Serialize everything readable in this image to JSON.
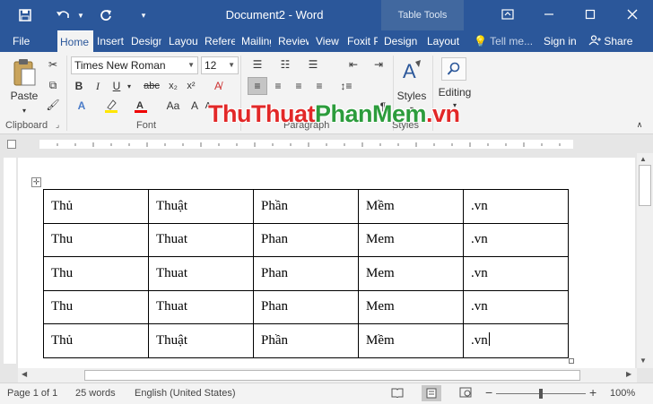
{
  "window": {
    "title": "Document2 - Word",
    "context_tab_group": "Table Tools",
    "accent_color": "#2b579a"
  },
  "quick_access": {
    "save_icon": "save-icon",
    "undo_icon": "undo-icon",
    "redo_icon": "redo-icon",
    "customize_icon": "chevron-down-icon"
  },
  "tabs": [
    {
      "label": "File",
      "active": false
    },
    {
      "label": "Home",
      "active": true
    },
    {
      "label": "Insert",
      "active": false
    },
    {
      "label": "Design",
      "active": false
    },
    {
      "label": "Layout",
      "active": false
    },
    {
      "label": "References",
      "active": false
    },
    {
      "label": "Mailings",
      "active": false
    },
    {
      "label": "Review",
      "active": false
    },
    {
      "label": "View",
      "active": false
    },
    {
      "label": "Foxit PDF",
      "active": false
    },
    {
      "label": "Design",
      "active": false
    },
    {
      "label": "Layout",
      "active": false
    }
  ],
  "tell_me": "Tell me...",
  "sign_in": "Sign in",
  "share": "Share",
  "ribbon": {
    "paste": "Paste",
    "font_name": "Times New Roman",
    "font_size": "12",
    "styles": "Styles",
    "editing": "Editing",
    "groups": [
      "Clipboard",
      "Font",
      "Paragraph",
      "Styles"
    ]
  },
  "watermark": {
    "part1": "ThuThuat",
    "part2": "PhanMem",
    "part3": ".vn"
  },
  "table": {
    "rows": [
      [
        "Thủ",
        "Thuật",
        "Phần",
        "Mềm",
        ".vn"
      ],
      [
        "Thu",
        "Thuat",
        "Phan",
        "Mem",
        ".vn"
      ],
      [
        "Thu",
        "Thuat",
        "Phan",
        "Mem",
        ".vn"
      ],
      [
        "Thu",
        "Thuat",
        "Phan",
        "Mem",
        ".vn"
      ],
      [
        "Thủ",
        "Thuật",
        "Phần",
        "Mềm",
        ".vn"
      ]
    ]
  },
  "status": {
    "page": "Page 1 of 1",
    "words": "25 words",
    "language": "English (United States)",
    "zoom": "100%",
    "zoom_minus": "−",
    "zoom_plus": "+"
  }
}
